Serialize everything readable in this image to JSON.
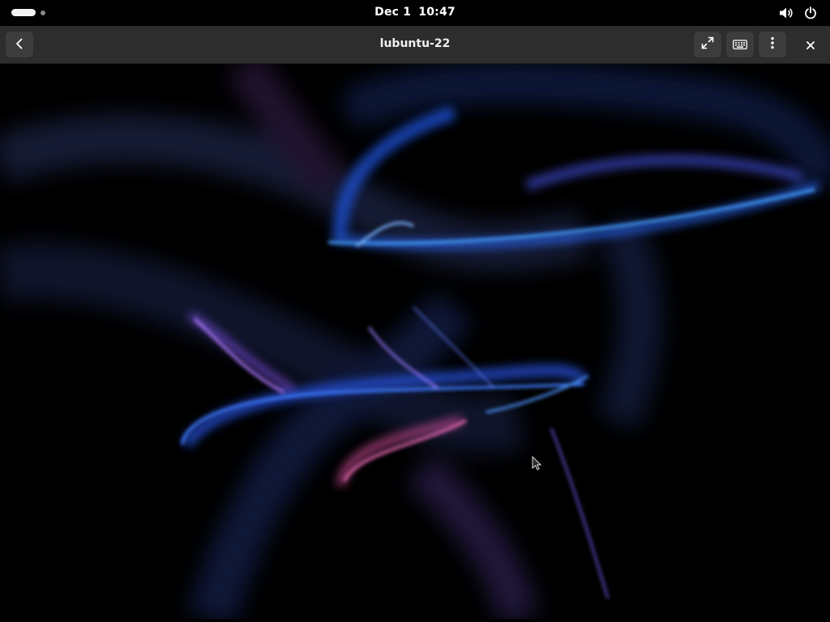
{
  "top_bar": {
    "date": "Dec 1",
    "time": "10:47",
    "icons": [
      "activities-indicator",
      "volume-icon",
      "power-icon"
    ]
  },
  "header_bar": {
    "title": "lubuntu-22",
    "buttons": [
      "back-arrow-icon",
      "fullscreen-icon",
      "keyboard-icon",
      "menu-kebab-icon",
      "close-icon"
    ]
  },
  "colors": {
    "topbar_bg": "#000000",
    "headerbar_bg": "#2d2d2d",
    "button_bg": "#3c3c3c",
    "ribbon_blue": "#2f7dff",
    "ribbon_violet": "#8a5cff",
    "ribbon_pink": "#e05aa8"
  }
}
